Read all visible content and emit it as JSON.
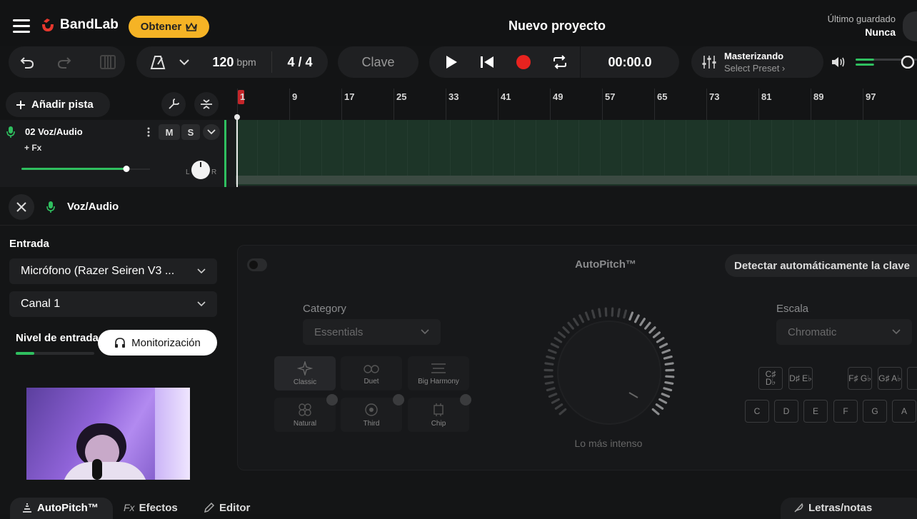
{
  "topbar": {
    "logo": "BandLab",
    "upgrade_label": "Obtener",
    "project_title": "Nuevo proyecto",
    "last_saved_label": "Último guardado",
    "last_saved_value": "Nunca"
  },
  "transport": {
    "bpm_value": "120",
    "bpm_unit": "bpm",
    "time_signature": "4 / 4",
    "key_label": "Clave",
    "time_display": "00:00.0",
    "mastering_title": "Masterizando",
    "mastering_sub": "Select Preset ›",
    "volume_level": 0.3
  },
  "tracks_panel": {
    "add_track_label": "Añadir pista",
    "track": {
      "name": "02 Voz/Audio",
      "fx_label": "+ Fx",
      "mute": "M",
      "solo": "S",
      "pan_left": "L",
      "pan_right": "R",
      "volume_level": 0.75
    }
  },
  "ruler": {
    "bars": [
      "1",
      "9",
      "17",
      "25",
      "33",
      "41",
      "49",
      "57",
      "65",
      "73",
      "81",
      "89",
      "97"
    ]
  },
  "instrument_panel": {
    "title": "Voz/Audio",
    "input_label": "Entrada",
    "input_device": "Micrófono (Razer Seiren V3 ...",
    "channel": "Canal 1",
    "level_label": "Nivel de entrada",
    "monitor_label": "Monitorización"
  },
  "autopitch": {
    "title": "AutoPitch™",
    "detect_key_label": "Detectar automáticamente la clave",
    "category_label": "Category",
    "category_value": "Essentials",
    "scale_label": "Escala",
    "scale_value": "Chromatic",
    "intensity_label": "Lo más intenso",
    "presets": [
      "Classic",
      "Duet",
      "Big Harmony",
      "Natural",
      "Third",
      "Chip"
    ],
    "keys_sharp": [
      "C♯ D♭",
      "D♯ E♭",
      "F♯ G♭",
      "G♯ A♭"
    ],
    "keys_natural": [
      "C",
      "D",
      "E",
      "F",
      "G",
      "A"
    ]
  },
  "bottom_tabs": {
    "autopitch": "AutoPitch™",
    "fx_prefix": "Fx",
    "effects": "Efectos",
    "editor": "Editor",
    "lyrics": "Letras/notas"
  }
}
